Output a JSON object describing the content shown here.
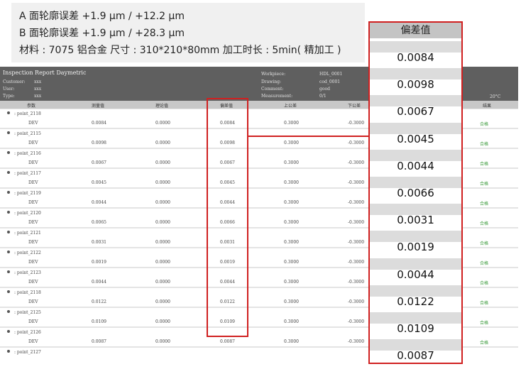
{
  "spec": {
    "line1": "A 面轮廓误差 +1.9 μm / +12.2 μm",
    "line2": "B 面轮廓误差 +1.9 μm / +28.3 μm",
    "line3": "材料 : 7075 铝合金  尺寸 : 310*210*80mm   加工时长 : 5min( 精加工 )"
  },
  "report": {
    "title": "Inspection Report Daymetric",
    "customer_label": "Customer:",
    "customer_value": "xxx",
    "user_label": "User:",
    "user_value": "xxx",
    "type_label": "Type:",
    "type_value": "xxx",
    "workpiece_label": "Workpiece:",
    "workpiece_value": "HDL_0001",
    "drawing_label": "Drawing:",
    "drawing_value": "cod_0001",
    "comment_label": "Comment:",
    "comment_value": "good",
    "measurement_label": "Measurement:",
    "measurement_value": "0/1",
    "temperature": "20°C",
    "columns": [
      "参数",
      "测量值",
      "理论值",
      "偏差值",
      "上公差",
      "下公差",
      "结果"
    ],
    "rows": [
      {
        "name": ": point_2118",
        "dev_label": "DEV",
        "measured": "0.0084",
        "nominal": "0.0000",
        "deviation": "0.0084",
        "upper": "0.3000",
        "lower": "-0.3000",
        "result": "合格"
      },
      {
        "name": ": point_2115",
        "dev_label": "DEV",
        "measured": "0.0098",
        "nominal": "0.0000",
        "deviation": "0.0098",
        "upper": "0.3000",
        "lower": "-0.3000",
        "result": "合格"
      },
      {
        "name": ": point_2116",
        "dev_label": "DEV",
        "measured": "0.0067",
        "nominal": "0.0000",
        "deviation": "0.0067",
        "upper": "0.3000",
        "lower": "-0.3000",
        "result": "合格"
      },
      {
        "name": ": point_2117",
        "dev_label": "DEV",
        "measured": "0.0045",
        "nominal": "0.0000",
        "deviation": "0.0045",
        "upper": "0.3000",
        "lower": "-0.3000",
        "result": "合格"
      },
      {
        "name": ": point_2119",
        "dev_label": "DEV",
        "measured": "0.0044",
        "nominal": "0.0000",
        "deviation": "0.0044",
        "upper": "0.3000",
        "lower": "-0.3000",
        "result": "合格"
      },
      {
        "name": ": point_2120",
        "dev_label": "DEV",
        "measured": "0.0065",
        "nominal": "0.0000",
        "deviation": "0.0066",
        "upper": "0.3000",
        "lower": "-0.3000",
        "result": "合格"
      },
      {
        "name": ": point_2121",
        "dev_label": "DEV",
        "measured": "0.0031",
        "nominal": "0.0000",
        "deviation": "0.0031",
        "upper": "0.3000",
        "lower": "-0.3000",
        "result": "合格"
      },
      {
        "name": ": point_2122",
        "dev_label": "DEV",
        "measured": "0.0019",
        "nominal": "0.0000",
        "deviation": "0.0019",
        "upper": "0.3000",
        "lower": "-0.3000",
        "result": "合格"
      },
      {
        "name": ": point_2123",
        "dev_label": "DEV",
        "measured": "0.0044",
        "nominal": "0.0000",
        "deviation": "0.0044",
        "upper": "0.3000",
        "lower": "-0.3000",
        "result": "合格"
      },
      {
        "name": ": point_2118",
        "dev_label": "DEV",
        "measured": "0.0122",
        "nominal": "0.0000",
        "deviation": "0.0122",
        "upper": "0.3000",
        "lower": "-0.3000",
        "result": "合格"
      },
      {
        "name": ": point_2125",
        "dev_label": "DEV",
        "measured": "0.0109",
        "nominal": "0.0000",
        "deviation": "0.0109",
        "upper": "0.3000",
        "lower": "-0.3000",
        "result": "合格"
      },
      {
        "name": ": point_2126",
        "dev_label": "DEV",
        "measured": "0.0087",
        "nominal": "0.0000",
        "deviation": "0.0087",
        "upper": "0.3000",
        "lower": "-0.3000",
        "result": "合格"
      }
    ],
    "last_row_name": ": point_2127"
  },
  "panel": {
    "title": "偏差值",
    "values": [
      "0.0084",
      "0.0098",
      "0.0067",
      "0.0045",
      "0.0044",
      "0.0066",
      "0.0031",
      "0.0019",
      "0.0044",
      "0.0122",
      "0.0109",
      "0.0087"
    ]
  },
  "colors": {
    "highlight": "#d02020",
    "pass": "#3a9a3a",
    "header_bg": "#5f5f5f"
  }
}
